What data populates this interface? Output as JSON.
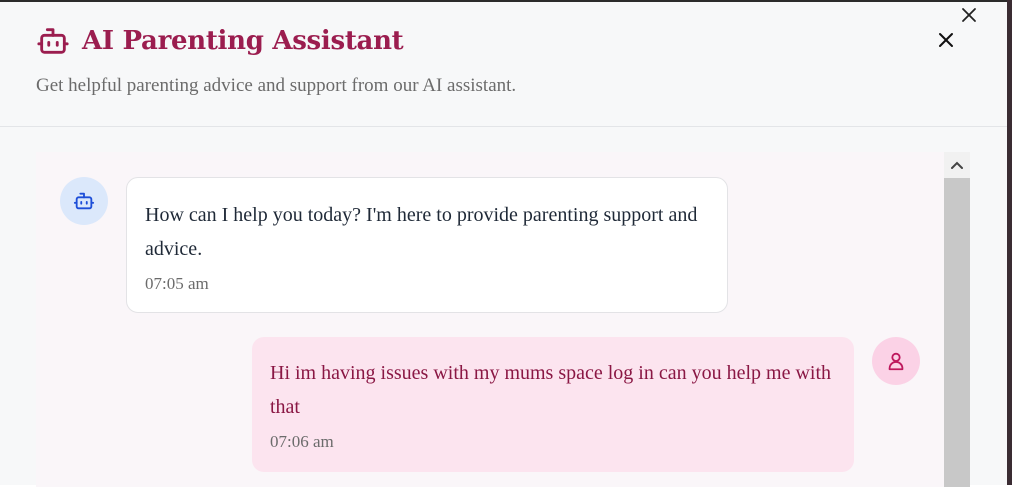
{
  "header": {
    "title": "AI Parenting Assistant",
    "subtitle": "Get helpful parenting advice and support from our AI assistant."
  },
  "icons": {
    "title": "bot-icon",
    "close": "close-icon",
    "bot_avatar": "bot-icon",
    "user_avatar": "user-icon",
    "scroll_up": "chevron-up-icon"
  },
  "colors": {
    "brand": "#9b1d4f",
    "user_bubble": "#fce4ef",
    "bot_avatar_bg": "#dbe8fb",
    "user_avatar_bg": "#fbd2e6"
  },
  "messages": [
    {
      "sender": "assistant",
      "text": "How can I help you today? I'm here to provide parenting support and advice.",
      "time": "07:05 am"
    },
    {
      "sender": "user",
      "text": "Hi im having issues with my mums space log in can you help me with that",
      "time": "07:06 am"
    }
  ]
}
